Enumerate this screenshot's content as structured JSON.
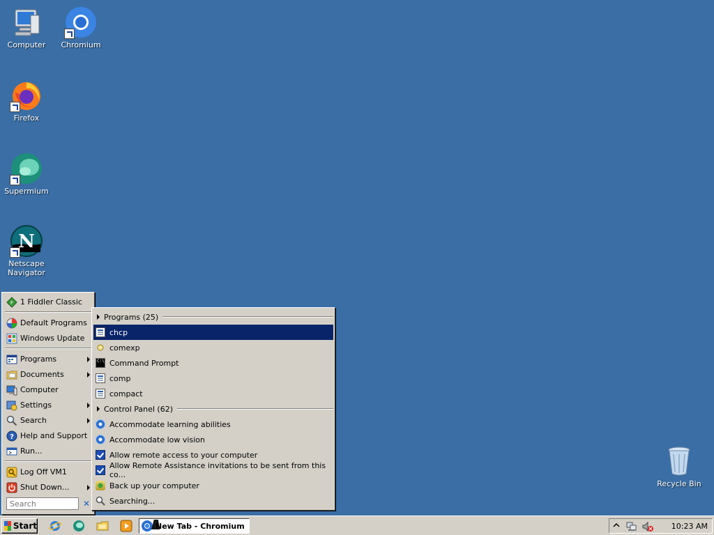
{
  "desktop": {
    "icons": [
      {
        "label": "Computer",
        "icon": "computer-icon"
      },
      {
        "label": "Chromium",
        "icon": "chromium-icon"
      },
      {
        "label": "Firefox",
        "icon": "firefox-icon"
      },
      {
        "label": "Supermium",
        "icon": "supermium-icon"
      },
      {
        "label": "Netscape Navigator",
        "icon": "netscape-icon"
      },
      {
        "label": "Recycle Bin",
        "icon": "recycle-bin-icon"
      }
    ]
  },
  "start_menu": {
    "pinned": [
      {
        "label": "1 Fiddler Classic",
        "icon": "fiddler-icon"
      }
    ],
    "top": [
      {
        "label": "Default Programs",
        "icon": "default-programs-icon"
      },
      {
        "label": "Windows Update",
        "icon": "windows-update-icon"
      }
    ],
    "main": [
      {
        "label": "Programs",
        "icon": "programs-icon",
        "submenu": true
      },
      {
        "label": "Documents",
        "icon": "documents-icon",
        "submenu": true
      },
      {
        "label": "Computer",
        "icon": "computer-icon",
        "submenu": false
      },
      {
        "label": "Settings",
        "icon": "settings-icon",
        "submenu": true
      },
      {
        "label": "Search",
        "icon": "search-icon",
        "submenu": true
      },
      {
        "label": "Help and Support",
        "icon": "help-icon",
        "submenu": false
      },
      {
        "label": "Run...",
        "icon": "run-icon",
        "submenu": false
      }
    ],
    "bottom": [
      {
        "label": "Log Off VM1",
        "icon": "log-off-icon",
        "submenu": false
      },
      {
        "label": "Shut Down...",
        "icon": "shut-down-icon",
        "submenu": true
      }
    ],
    "search": {
      "placeholder": "Search",
      "value": ""
    }
  },
  "results": {
    "groups": [
      {
        "header": "Programs (25)",
        "items": [
          {
            "label": "chcp",
            "icon": "document-icon",
            "selected": true
          },
          {
            "label": "comexp",
            "icon": "gear-icon",
            "selected": false
          },
          {
            "label": "Command Prompt",
            "icon": "command-prompt-icon",
            "selected": false
          },
          {
            "label": "comp",
            "icon": "document-icon",
            "selected": false
          },
          {
            "label": "compact",
            "icon": "document-icon",
            "selected": false
          }
        ]
      },
      {
        "header": "Control Panel (62)",
        "items": [
          {
            "label": "Accommodate learning abilities",
            "icon": "accessibility-icon",
            "selected": false
          },
          {
            "label": "Accommodate low vision",
            "icon": "accessibility-icon",
            "selected": false
          },
          {
            "label": "Allow remote access to your computer",
            "icon": "checkbox-icon",
            "selected": false
          },
          {
            "label": "Allow Remote Assistance invitations to be sent from this co...",
            "icon": "checkbox-icon",
            "selected": false
          },
          {
            "label": "Back up your computer",
            "icon": "backup-icon",
            "selected": false
          }
        ]
      }
    ],
    "status": "Searching..."
  },
  "taskbar": {
    "start_label": "Start",
    "quick_launch": [
      "internet-explorer-icon",
      "supermium-icon",
      "explorer-icon",
      "media-player-icon"
    ],
    "tasks": [
      {
        "label": "New Tab - Chromium",
        "icon": "chromium-icon",
        "active": true
      }
    ],
    "tray": {
      "icons": [
        "show-hidden-icons-icon",
        "network-icon",
        "volume-muted-icon"
      ],
      "clock": "10:23 AM"
    }
  }
}
